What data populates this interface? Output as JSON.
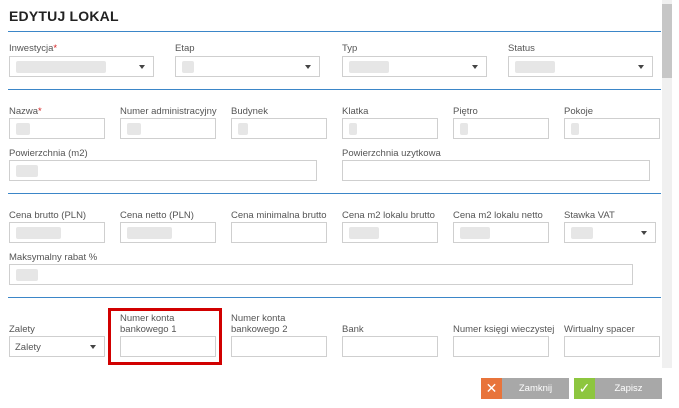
{
  "title": "EDYTUJ LOKAL",
  "section1": {
    "inwestycja_label": "Inwestycja",
    "etap_label": "Etap",
    "typ_label": "Typ",
    "status_label": "Status"
  },
  "section2": {
    "nazwa_label": "Nazwa",
    "numer_admin_label": "Numer administracyjny",
    "budynek_label": "Budynek",
    "klatka_label": "Klatka",
    "pietro_label": "Piętro",
    "pokoje_label": "Pokoje",
    "powierzchnia_label": "Powierzchnia (m2)",
    "powierzchnia_uzytkowa_label": "Powierzchnia uzytkowa"
  },
  "section3": {
    "cena_brutto_label": "Cena brutto (PLN)",
    "cena_netto_label": "Cena netto (PLN)",
    "cena_min_label": "Cena minimalna brutto",
    "cena_m2_brutto_label": "Cena m2 lokalu brutto",
    "cena_m2_netto_label": "Cena m2 lokalu netto",
    "stawka_vat_label": "Stawka VAT",
    "maks_rabat_label": "Maksymalny rabat %"
  },
  "section4": {
    "zalety_label": "Zalety",
    "zalety_value": "Zalety",
    "konto1_label_line1": "Numer konta",
    "konto1_label_line2": "bankowego 1",
    "konto2_label_line1": "Numer konta",
    "konto2_label_line2": "bankowego 2",
    "bank_label": "Bank",
    "ksiega_label": "Numer księgi wieczystej",
    "spacer_label": "Wirtualny spacer"
  },
  "buttons": {
    "close_label": "Zamknij",
    "save_label": "Zapisz"
  },
  "colors": {
    "accent_line": "#3b86c8",
    "close_icon_bg": "#e8743b",
    "save_icon_bg": "#8dc63f",
    "button_text_bg": "#a8a8a8",
    "highlight": "#d10000",
    "required": "#d42020"
  },
  "icons": {
    "close": "close-icon",
    "save": "check-icon",
    "dropdown": "chevron-down-icon"
  }
}
